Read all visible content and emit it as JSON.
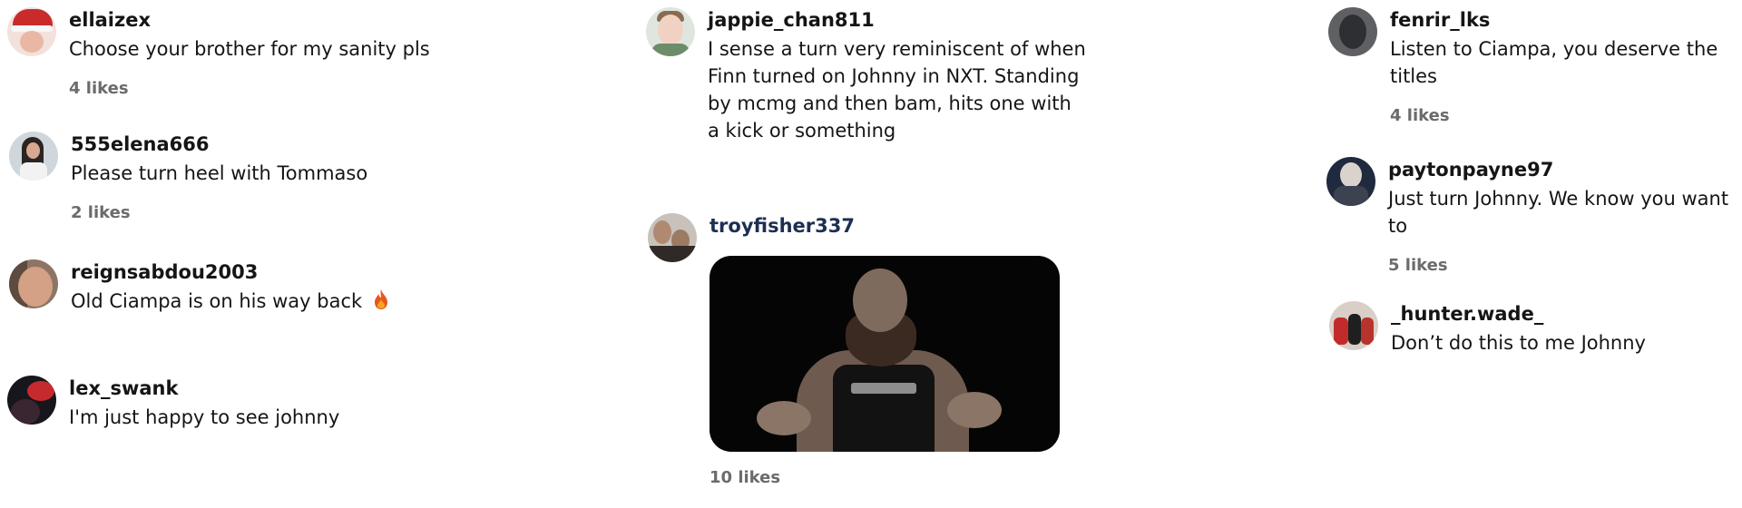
{
  "columns": [
    {
      "comments": [
        {
          "username": "ellaizex",
          "text": "Choose your brother for my sanity pls",
          "likes": "4 likes"
        },
        {
          "username": "555elena666",
          "text": "Please turn heel with Tommaso",
          "likes": "2 likes"
        },
        {
          "username": "reignsabdou2003",
          "text": "Old Ciampa is on his way back",
          "emoji_icon": "fire-emoji-icon"
        },
        {
          "username": "lex_swank",
          "text": "I'm just happy to see johnny"
        }
      ]
    },
    {
      "comments": [
        {
          "username": "jappie_chan811",
          "text": "I sense a turn very reminiscent of when Finn turned on Johnny in NXT. Standing by mcmg and then bam, hits one with a kick or something"
        },
        {
          "username": "troyfisher337",
          "media": "gif-image",
          "likes": "10 likes"
        }
      ]
    },
    {
      "comments": [
        {
          "username": "fenrir_lks",
          "text": "Listen to Ciampa, you deserve the titles",
          "likes": "4 likes"
        },
        {
          "username": "paytonpayne97",
          "text": "Just turn Johnny. We know you want to",
          "likes": "5 likes"
        },
        {
          "username": "_hunter.wade_",
          "text": "Don’t do this to me Johnny"
        }
      ]
    }
  ],
  "colors": {
    "text": "#151515",
    "muted": "#6b6b6b",
    "link_username": "#1d2f52",
    "flame": "#e8561c"
  }
}
